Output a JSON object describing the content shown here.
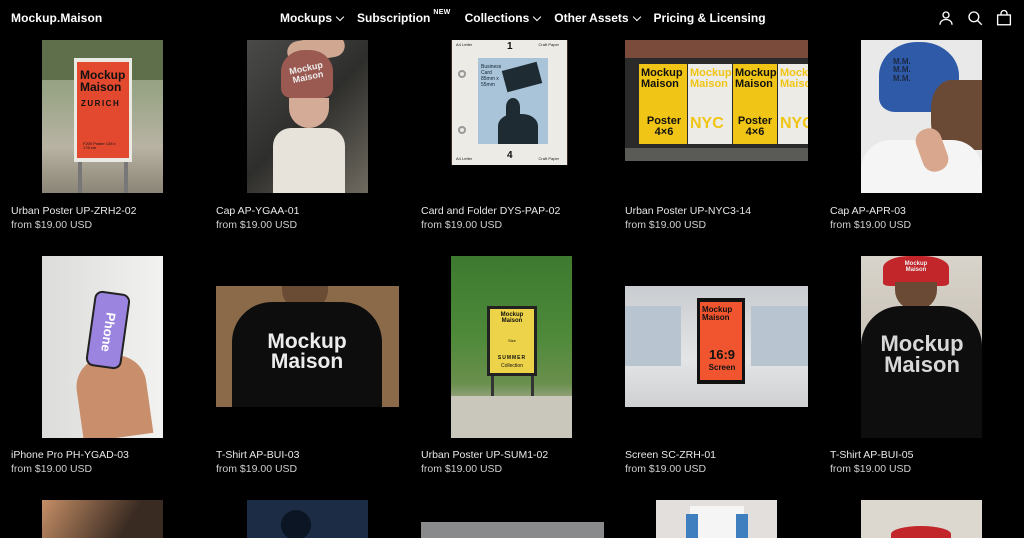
{
  "header": {
    "logo": "Mockup.Maison",
    "nav": [
      {
        "label": "Mockups",
        "chevron": true
      },
      {
        "label": "Subscription",
        "badge": "NEW"
      },
      {
        "label": "Collections",
        "chevron": true
      },
      {
        "label": "Other Assets",
        "chevron": true
      },
      {
        "label": "Pricing & Licensing"
      }
    ],
    "icons": [
      "account-icon",
      "search-icon",
      "cart-icon"
    ]
  },
  "products": [
    {
      "title": "Urban Poster UP-ZRH2-02",
      "price": "from $19.00 USD",
      "art": {
        "brand": "Mockup Maison",
        "city": "ZURICH",
        "small": "F200 Poster 128 x 178 cm"
      }
    },
    {
      "title": "Cap AP-YGAA-01",
      "price": "from $19.00 USD",
      "art": {
        "cap": "Mockup Maison"
      }
    },
    {
      "title": "Card and Folder DYS-PAP-02",
      "price": "from $19.00 USD",
      "art": {
        "top_num": "1",
        "bottom_num": "4",
        "corner_l": "A4 Letter",
        "corner_r": "Craft Paper",
        "card": "Business Card 85mm x 55mm"
      }
    },
    {
      "title": "Urban Poster UP-NYC3-14",
      "price": "from $19.00 USD",
      "art": {
        "brand": "Mockup Maison",
        "nyc": "NYC",
        "poster": "Poster 4×6"
      }
    },
    {
      "title": "Cap AP-APR-03",
      "price": "from $19.00 USD",
      "art": {
        "cap": "M.M. M.M. M.M."
      }
    },
    {
      "title": "iPhone Pro PH-YGAD-03",
      "price": "from $19.00 USD",
      "art": {
        "screen": "Phone"
      }
    },
    {
      "title": "T-Shirt AP-BUI-03",
      "price": "from $19.00 USD",
      "art": {
        "shirt": "Mockup Maison"
      }
    },
    {
      "title": "Urban Poster UP-SUM1-02",
      "price": "from $19.00 USD",
      "art": {
        "brand": "Mockup Maison",
        "mid": "Size",
        "summer": "SUMMER",
        "collection": "Collection"
      }
    },
    {
      "title": "Screen SC-ZRH-01",
      "price": "from $19.00 USD",
      "art": {
        "brand": "Mockup Maison",
        "ratio": "16:9",
        "screen": "Screen"
      }
    },
    {
      "title": "T-Shirt AP-BUI-05",
      "price": "from $19.00 USD",
      "art": {
        "shirt": "Mockup Maison",
        "cap": "Mockup Maison"
      }
    }
  ]
}
